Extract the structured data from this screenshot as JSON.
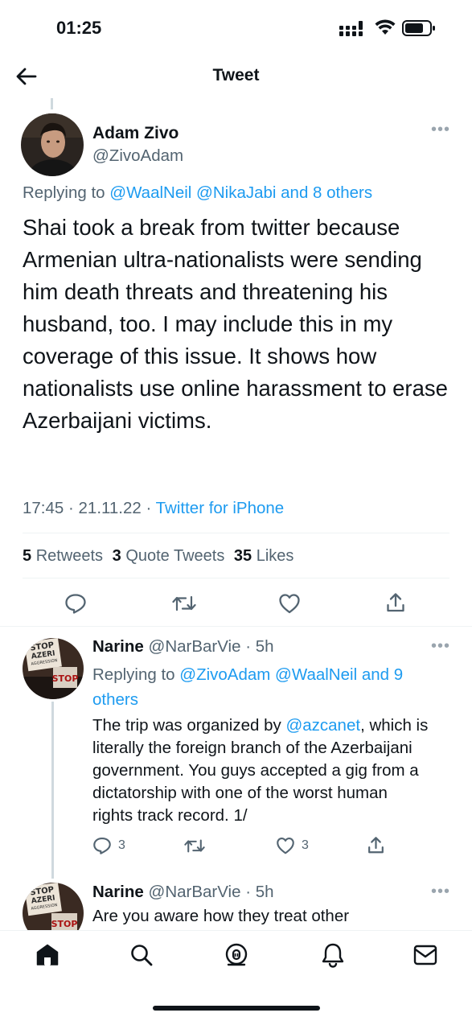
{
  "status_bar": {
    "time": "01:25"
  },
  "header": {
    "title": "Tweet"
  },
  "main_tweet": {
    "author_name": "Adam Zivo",
    "author_handle": "@ZivoAdam",
    "replying_prefix": "Replying to",
    "replying_users": "@WaalNeil @NikaJabi and 8 others",
    "text": "Shai took a break from twitter because Armenian ultra-nationalists were sending him death threats and threatening his husband, too. I may include this in my coverage of this issue. It shows how nationalists use online harassment to erase Azerbaijani victims.",
    "time": "17:45 · 21.11.22 · ",
    "source": "Twitter for iPhone",
    "stats": {
      "retweets_count": "5",
      "retweets_label": "Retweets",
      "quotes_count": "3",
      "quotes_label": "Quote Tweets",
      "likes_count": "35",
      "likes_label": "Likes"
    }
  },
  "replies": [
    {
      "author_name": "Narine",
      "author_handle": "@NarBarVie",
      "time": " · 5h",
      "replying_prefix": "Replying to",
      "replying_users_line1": "@ZivoAdam @WaalNeil and 9",
      "replying_users_line2": "others",
      "text_before_mention": "The trip was organized by ",
      "mention": "@azcanet",
      "text_line1_after": ", which is",
      "text_line2": "literally the foreign branch of the Azerbaijani",
      "text_line3": "government. You guys accepted a gig from a",
      "text_line4": "dictatorship with one of the worst human",
      "text_line5": "rights track record. 1/",
      "reply_count": "3",
      "like_count": "3"
    },
    {
      "author_name": "Narine",
      "author_handle": "@NarBarVie",
      "time": " · 5h",
      "text": "Are you aware how they treat other"
    }
  ],
  "avatar_sign_text": {
    "line1": "STOP",
    "line2": "AZERI",
    "line3": "AGGRESSION",
    "line4": "STOP"
  },
  "colors": {
    "accent": "#1d9bf0",
    "text": "#0f1419",
    "secondary": "#536471"
  },
  "nav_icons": [
    "home-icon",
    "search-icon",
    "spaces-icon",
    "notifications-icon",
    "messages-icon"
  ]
}
